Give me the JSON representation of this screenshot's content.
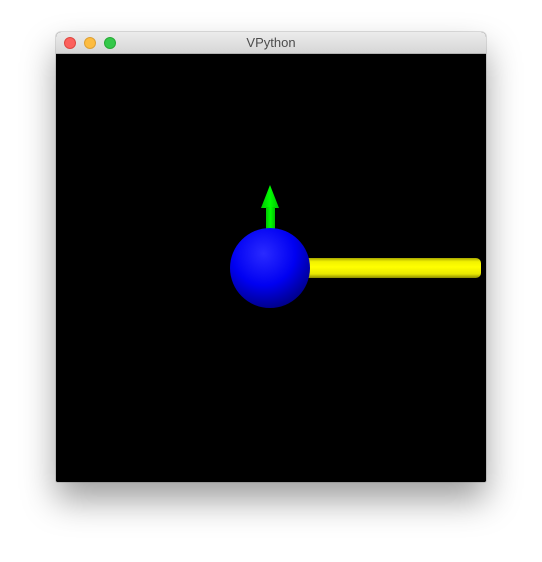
{
  "window": {
    "title": "VPython"
  },
  "scene": {
    "background": "#000000",
    "objects": [
      {
        "type": "sphere",
        "color": "#0000ff"
      },
      {
        "type": "arrow",
        "color": "#00e000",
        "direction": "up"
      },
      {
        "type": "cylinder",
        "color": "#ffff00",
        "direction": "right"
      }
    ]
  }
}
